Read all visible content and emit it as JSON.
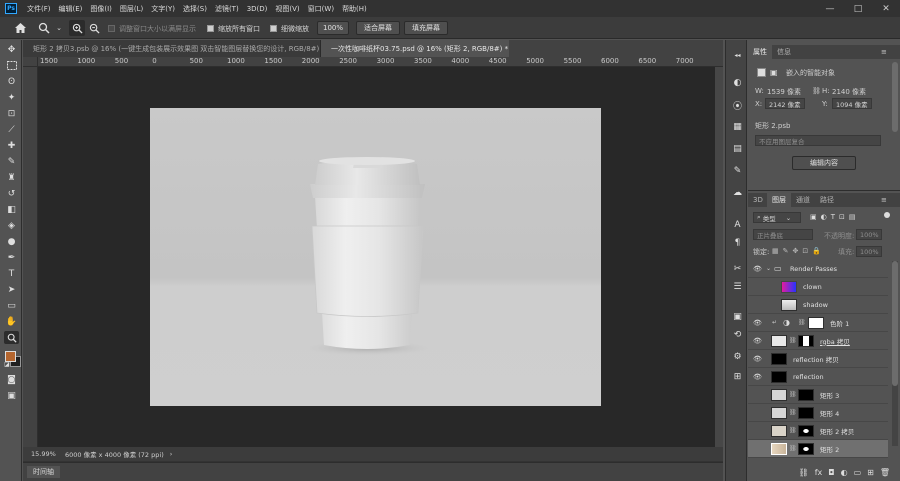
{
  "menubar": {
    "app_badge": "Ps",
    "items": [
      "文件(F)",
      "编辑(E)",
      "图像(I)",
      "图层(L)",
      "文字(Y)",
      "选择(S)",
      "滤镜(T)",
      "3D(D)",
      "视图(V)",
      "窗口(W)",
      "帮助(H)"
    ]
  },
  "window_controls": {
    "minimize": "—",
    "maximize": "□",
    "close": "✕"
  },
  "options_bar": {
    "home_icon": "home-icon",
    "zoom_tool_icon": "zoom-icon",
    "resize_windows_label": "调整窗口大小以满屏显示",
    "resize_windows_checked": false,
    "zoom_all_label": "缩放所有窗口",
    "zoom_all_checked": true,
    "scrubby_zoom_label": "细微缩放",
    "scrubby_zoom_checked": true,
    "zoom_100_label": "100%",
    "fit_screen_label": "适合屏幕",
    "fill_screen_label": "填充屏幕"
  },
  "tabs": [
    {
      "label": "矩形 2 拷贝3.psb @ 16% (一键生成包装展示效果图 双击智能图层替换您的设计, RGB/8#) *",
      "close": "×",
      "active": false
    },
    {
      "label": "一次性咖啡纸杯03.75.psd @ 16% (矩形 2, RGB/8#) *",
      "close": "×",
      "active": true
    }
  ],
  "ruler": {
    "top_labels": [
      "1500",
      "1000",
      "500",
      "0",
      "500",
      "1000",
      "1500",
      "2000",
      "2500",
      "3000",
      "3500",
      "4000",
      "4500",
      "5000",
      "5500",
      "6000",
      "6500",
      "7000"
    ]
  },
  "status": {
    "zoom": "15.99%",
    "doc_info": "6000 像素 x 4000 像素 (72 ppi)",
    "arrow": "›"
  },
  "timeline": {
    "label": "时间轴"
  },
  "properties": {
    "tab_properties": "属性",
    "tab_info": "信息",
    "object_type": "嵌入的智能对象",
    "w_label": "W:",
    "w_value": "1539 像素",
    "h_label": "H:",
    "h_value": "2140 像素",
    "x_label": "X:",
    "x_value": "2142 像素",
    "y_label": "Y:",
    "y_value": "1094 像素",
    "file_name": "矩形 2.psb",
    "comp_placeholder": "不应用图层复合",
    "edit_contents_label": "编辑内容"
  },
  "layers_panel": {
    "tab_3d": "3D",
    "tab_layers": "图层",
    "tab_channels": "通道",
    "tab_paths": "路径",
    "filter_label": "类型",
    "blend_mode": "正片叠底",
    "opacity_label": "不透明度:",
    "opacity_value": "100%",
    "lock_label": "锁定:",
    "fill_label": "填充:",
    "fill_value": "100%",
    "layers": [
      {
        "name": "Render Passes",
        "kind": "group",
        "visible": true
      },
      {
        "name": "clown",
        "kind": "image",
        "visible": false
      },
      {
        "name": "shadow",
        "kind": "image",
        "visible": false
      },
      {
        "name": "色阶 1",
        "kind": "adjustment",
        "visible": true
      },
      {
        "name": "rgba 拷贝",
        "kind": "masked",
        "visible": true
      },
      {
        "name": "reflection 拷贝",
        "kind": "black",
        "visible": true
      },
      {
        "name": "reflection",
        "kind": "black",
        "visible": true
      },
      {
        "name": "矩形 3",
        "kind": "smart",
        "visible": false
      },
      {
        "name": "矩形 4",
        "kind": "smart",
        "visible": false
      },
      {
        "name": "矩形 2 拷贝",
        "kind": "smart",
        "visible": false
      },
      {
        "name": "矩形 2",
        "kind": "smart",
        "visible": false,
        "selected": true
      }
    ],
    "footer_icons": [
      "link-icon",
      "fx-icon",
      "mask-icon",
      "adjustment-icon",
      "group-icon",
      "new-layer-icon",
      "trash-icon"
    ]
  },
  "colors": {
    "foreground": "#b5662f",
    "background": "#1f1f1f",
    "accent": "#31a8ff"
  }
}
